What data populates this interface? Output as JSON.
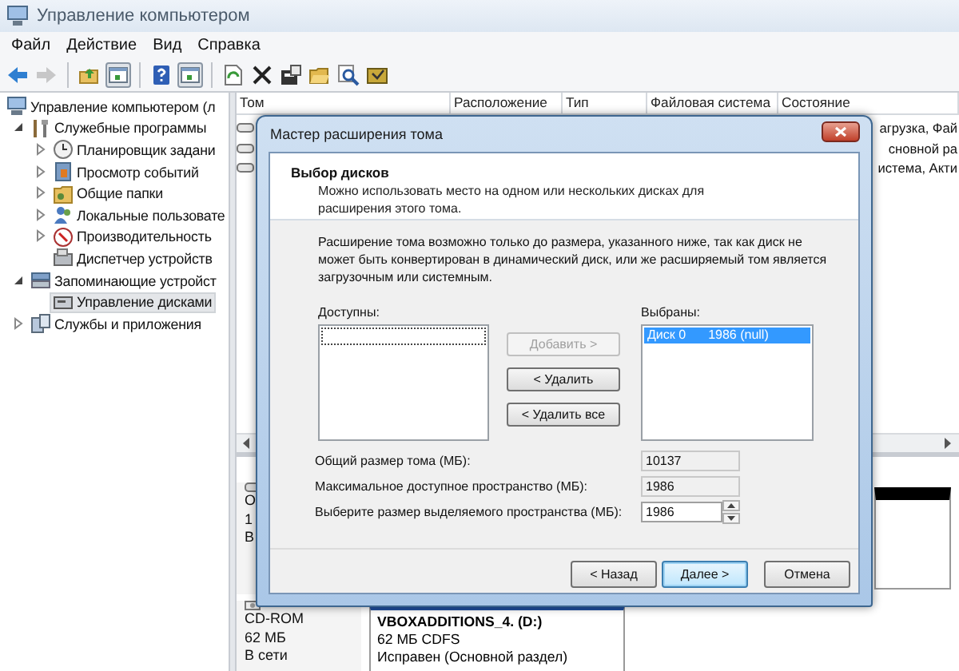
{
  "window": {
    "title": "Управление компьютером"
  },
  "menu": [
    "Файл",
    "Действие",
    "Вид",
    "Справка"
  ],
  "toolbar": [
    [
      {
        "kind": "back",
        "disabled": false,
        "pressed": false
      },
      {
        "kind": "forward",
        "disabled": true,
        "pressed": false
      }
    ],
    [
      {
        "kind": "up",
        "disabled": false,
        "pressed": false
      },
      {
        "kind": "pane",
        "disabled": false,
        "pressed": true
      }
    ],
    [
      {
        "kind": "help",
        "disabled": false,
        "pressed": false
      },
      {
        "kind": "pane",
        "disabled": false,
        "pressed": true
      }
    ],
    [
      {
        "kind": "export",
        "disabled": false,
        "pressed": false
      },
      {
        "kind": "delete",
        "disabled": false,
        "pressed": false
      },
      {
        "kind": "properties",
        "disabled": false,
        "pressed": false
      },
      {
        "kind": "open",
        "disabled": false,
        "pressed": false
      },
      {
        "kind": "find",
        "disabled": false,
        "pressed": false
      },
      {
        "kind": "wizard",
        "disabled": false,
        "pressed": false
      }
    ]
  ],
  "tree": [
    {
      "label": "Управление компьютером (л",
      "kind": "computer",
      "selected": false,
      "children": [
        {
          "label": "Служебные программы",
          "kind": "tools",
          "expandable": true,
          "expanded": true,
          "selected": false,
          "children": [
            {
              "label": "Планировщик задани",
              "kind": "clock",
              "expandable": true,
              "expanded": false,
              "selected": false
            },
            {
              "label": "Просмотр событий",
              "kind": "log",
              "expandable": true,
              "expanded": false,
              "selected": false
            },
            {
              "label": "Общие папки",
              "kind": "folder",
              "expandable": true,
              "expanded": false,
              "selected": false
            },
            {
              "label": "Локальные пользовате",
              "kind": "users",
              "expandable": true,
              "expanded": false,
              "selected": false
            },
            {
              "label": "Производительность",
              "kind": "perf",
              "expandable": true,
              "expanded": false,
              "selected": false
            },
            {
              "label": "Диспетчер устройств",
              "kind": "devices",
              "selected": false
            }
          ]
        },
        {
          "label": "Запоминающие устройст",
          "kind": "storage",
          "expandable": true,
          "expanded": true,
          "selected": false,
          "children": [
            {
              "label": "Управление дисками",
              "kind": "disk",
              "selected": true
            }
          ]
        },
        {
          "label": "Службы и приложения",
          "kind": "services",
          "expandable": true,
          "expanded": false,
          "selected": false
        }
      ]
    }
  ],
  "volumes": {
    "columns": [
      "Том",
      "Расположение",
      "Тип",
      "Файловая система",
      "Состояние"
    ],
    "rows": [
      {
        "status": "агрузка, Фай"
      },
      {
        "status": "сновной ра"
      },
      {
        "status": "истема, Акти"
      }
    ]
  },
  "disks": [
    {
      "kind": "disk",
      "lines": [
        "О",
        "1",
        "В"
      ],
      "partitions": [
        {
          "kind": "unallocated"
        }
      ]
    },
    {
      "kind": "cdrom",
      "lines": [
        "CD-ROM",
        "62 МБ",
        "В сети"
      ],
      "partitions": [
        {
          "kind": "primary",
          "name": "VBOXADDITIONS_4. (D:)",
          "lines": [
            "62 МБ CDFS",
            "Исправен (Основной раздел)"
          ]
        }
      ]
    }
  ],
  "wizard": {
    "title": "Мастер расширения тома",
    "heading": "Выбор дисков",
    "subtitle": "Можно использовать место на одном или нескольких дисках для расширения этого тома.",
    "note": "Расширение тома возможно только до размера, указанного ниже, так как диск не может быть конвертирован в динамический диск, или же расширяемый том является загрузочным или системным.",
    "available": {
      "label": "Доступны:"
    },
    "chosen": {
      "label": "Выбраны:",
      "items": [
        {
          "disk": "Диск 0",
          "size": "1986 (null)",
          "selected": true
        }
      ]
    },
    "transfer_buttons": [
      {
        "label": "Добавить >",
        "disabled": true
      },
      {
        "label": "< Удалить",
        "disabled": false
      },
      {
        "label": "< Удалить все",
        "disabled": false
      }
    ],
    "fields": [
      {
        "kind": "readonly",
        "label": "Общий размер тома (МБ):",
        "value": "10137"
      },
      {
        "kind": "readonly",
        "label": "Максимальное доступное пространство (МБ):",
        "value": "1986"
      },
      {
        "kind": "spin",
        "label": "Выберите размер выделяемого пространства (МБ):",
        "value": "1986"
      }
    ],
    "buttons": [
      {
        "label": "< Назад",
        "default": false
      },
      {
        "label": "Далее >",
        "default": true
      },
      {
        "label": "Отмена",
        "default": false
      }
    ]
  }
}
